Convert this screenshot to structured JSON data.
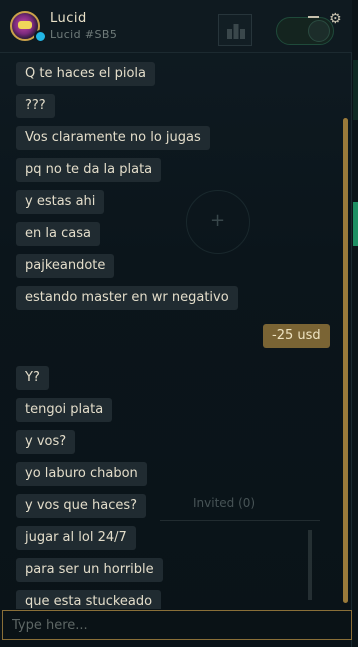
{
  "header": {
    "name": "Lucid",
    "tag": "Lucid #SB5"
  },
  "background": {
    "invited_label": "Invited (0)"
  },
  "messages": [
    {
      "text": "Q te haces el piola",
      "dir": "in"
    },
    {
      "text": "???",
      "dir": "in"
    },
    {
      "text": "Vos claramente no lo jugas",
      "dir": "in"
    },
    {
      "text": "pq no te da la plata",
      "dir": "in"
    },
    {
      "text": "y estas ahi",
      "dir": "in"
    },
    {
      "text": "en la casa",
      "dir": "in"
    },
    {
      "text": "pajkeandote",
      "dir": "in"
    },
    {
      "text": "estando master en wr negativo",
      "dir": "in"
    },
    {
      "text": "-25 usd",
      "dir": "out"
    },
    {
      "text": "Y?",
      "dir": "in"
    },
    {
      "text": "tengoi plata",
      "dir": "in"
    },
    {
      "text": "y vos?",
      "dir": "in"
    },
    {
      "text": "yo laburo chabon",
      "dir": "in"
    },
    {
      "text": "y vos que haces?",
      "dir": "in"
    },
    {
      "text": "jugar al lol 24/7",
      "dir": "in"
    },
    {
      "text": "para ser un horrible",
      "dir": "in"
    },
    {
      "text": "que esta stuckeado",
      "dir": "in"
    }
  ],
  "input": {
    "placeholder": "Type here...",
    "value": ""
  },
  "colors": {
    "incoming_bubble": "#202b31",
    "outgoing_bubble": "#7a6434",
    "accent_gold": "#9a7a3a",
    "status_online": "#22b7e6"
  },
  "icons": [
    "party-icon",
    "toggle-switch",
    "minimize-icon",
    "gear-icon"
  ]
}
